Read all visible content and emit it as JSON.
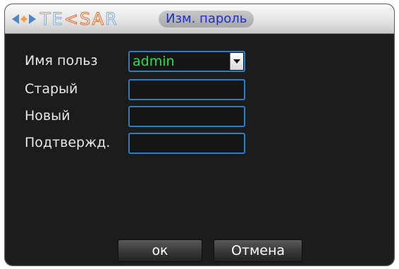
{
  "titlebar": {
    "logo_text_left": "TE",
    "logo_text_accent": "<S",
    "logo_text_a": "A",
    "logo_text_right": "R",
    "dialog_title": "Изм. пароль"
  },
  "form": {
    "username_label": "Имя польз",
    "username_value": "admin",
    "old_label": "Старый",
    "old_value": "",
    "new_label": "Новый",
    "new_value": "",
    "confirm_label": "Подтвержд.",
    "confirm_value": ""
  },
  "buttons": {
    "ok_label": "ок",
    "cancel_label": "Отмена"
  },
  "colors": {
    "window_bg": "#1c1c1c",
    "field_border": "#2e7cc6",
    "select_text": "#27e04a",
    "title_text": "#1c2fd0"
  }
}
